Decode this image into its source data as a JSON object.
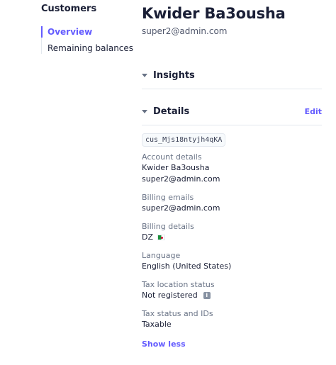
{
  "sidebar": {
    "title": "Customers",
    "items": [
      {
        "label": "Overview",
        "active": true
      },
      {
        "label": "Remaining balances",
        "active": false
      }
    ]
  },
  "customer": {
    "name": "Kwider Ba3ousha",
    "email": "super2@admin.com"
  },
  "sections": {
    "insights": {
      "title": "Insights"
    },
    "details": {
      "title": "Details",
      "edit_label": "Edit"
    }
  },
  "details": {
    "customer_id": "cus_Mjs18ntyjh4qKA",
    "account_details": {
      "label": "Account details",
      "name": "Kwider Ba3ousha",
      "email": "super2@admin.com"
    },
    "billing_emails": {
      "label": "Billing emails",
      "value": "super2@admin.com"
    },
    "billing_details": {
      "label": "Billing details",
      "value": "DZ",
      "flag_icon": "algeria-flag-icon"
    },
    "language": {
      "label": "Language",
      "value": "English (United States)"
    },
    "tax_location_status": {
      "label": "Tax location status",
      "value": "Not registered",
      "info_icon": "i"
    },
    "tax_status": {
      "label": "Tax status and IDs",
      "value": "Taxable"
    },
    "show_less_label": "Show less"
  },
  "colors": {
    "accent": "#635bff",
    "text": "#1a1f36",
    "muted": "#697386",
    "divider": "#e3e8ee"
  }
}
